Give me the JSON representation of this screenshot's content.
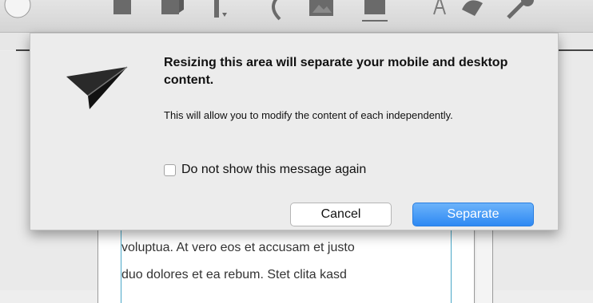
{
  "toolbar": {
    "icons": [
      "circle-icon",
      "square-icon",
      "square-icon",
      "insert-icon",
      "curve-icon",
      "image-icon",
      "media-icon",
      "text-icon",
      "shape-icon",
      "tools-icon"
    ]
  },
  "background_text": {
    "line1": "voluptua. At vero eos et accusam et justo",
    "line2": "duo dolores et ea rebum. Stet clita kasd"
  },
  "dialog": {
    "icon": "paper-plane-icon",
    "title": "Resizing this area will separate your mobile and desktop content.",
    "message": "This will allow you to modify the content of each independently.",
    "checkbox_label": "Do not show this message again",
    "checkbox_checked": false,
    "cancel_label": "Cancel",
    "separate_label": "Separate"
  },
  "colors": {
    "primary_button": "#2e89f3",
    "guide_line": "#4aa8c8"
  }
}
